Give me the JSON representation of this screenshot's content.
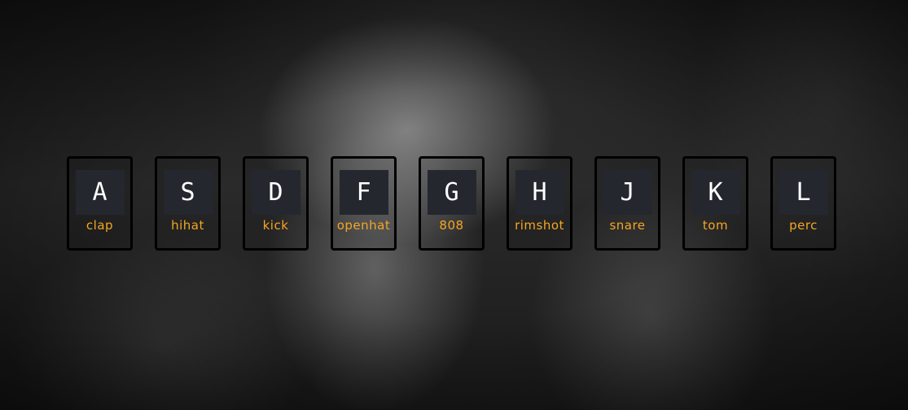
{
  "drum_kit": {
    "accent_color": "#f5a623",
    "keys": [
      {
        "key": "A",
        "sound": "clap"
      },
      {
        "key": "S",
        "sound": "hihat"
      },
      {
        "key": "D",
        "sound": "kick"
      },
      {
        "key": "F",
        "sound": "openhat"
      },
      {
        "key": "G",
        "sound": "808"
      },
      {
        "key": "H",
        "sound": "rimshot"
      },
      {
        "key": "J",
        "sound": "snare"
      },
      {
        "key": "K",
        "sound": "tom"
      },
      {
        "key": "L",
        "sound": "perc"
      }
    ]
  }
}
